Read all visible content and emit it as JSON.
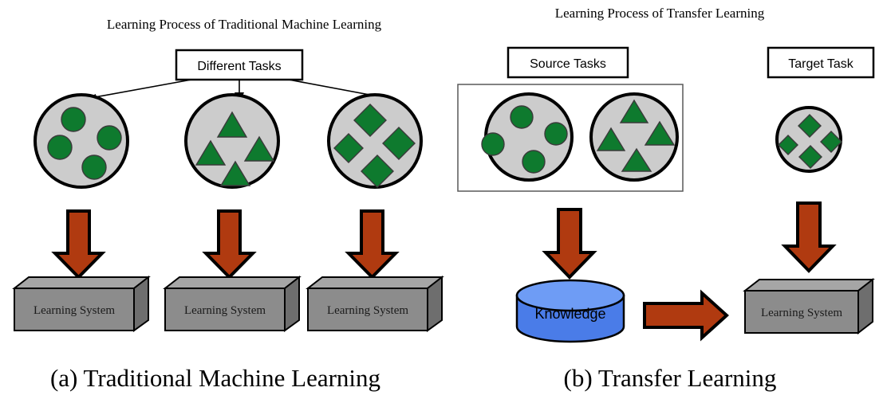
{
  "figure": {
    "caption_left": "(a)  Traditional Machine Learning",
    "caption_right": "(b)  Transfer Learning"
  },
  "panel_a": {
    "title": "Learning Process of Traditional Machine Learning",
    "source_box_label": "Different Tasks",
    "tasks": [
      {
        "shape": "circle",
        "count": 4,
        "system_label": "Learning System"
      },
      {
        "shape": "triangle",
        "count": 4,
        "system_label": "Learning System"
      },
      {
        "shape": "diamond",
        "count": 4,
        "system_label": "Learning System"
      }
    ]
  },
  "panel_b": {
    "title": "Learning Process of Transfer Learning",
    "source_box_label": "Source Tasks",
    "target_box_label": "Target Task",
    "source_tasks": [
      {
        "shape": "circle",
        "count": 4
      },
      {
        "shape": "triangle",
        "count": 4
      }
    ],
    "target_task": {
      "shape": "diamond",
      "count": 4
    },
    "knowledge_label": "Knowledge",
    "learning_system_label": "Learning System"
  },
  "colors": {
    "shape_fill": "#0e7a2e",
    "task_circle_fill": "#cccccc",
    "block_arrow_fill": "#b03a10",
    "knowledge_fill": "#4a7ce8",
    "learning_system_fill": "#8c8c8c",
    "outline": "#000000"
  }
}
